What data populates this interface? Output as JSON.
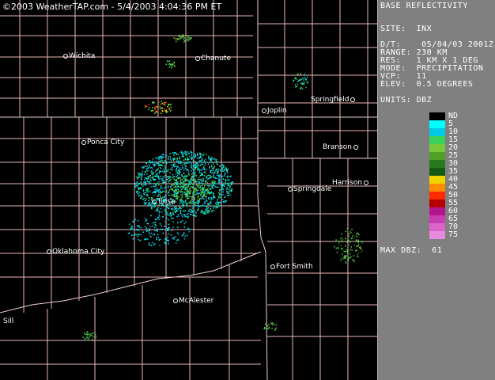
{
  "banner": "©2003 WeatherTAP.com - 5/4/2003 4:04:36 PM ET",
  "cities": [
    {
      "name": "Wichita",
      "dot_first": true
    },
    {
      "name": "Chanute",
      "dot_first": true
    },
    {
      "name": "Joplin",
      "dot_first": true
    },
    {
      "name": "Springfield",
      "dot_first": false
    },
    {
      "name": "Ponca City",
      "dot_first": true
    },
    {
      "name": "Branson",
      "dot_first": false
    },
    {
      "name": "Harrison",
      "dot_first": false
    },
    {
      "name": "Springdale",
      "dot_first": true
    },
    {
      "name": "Tulsa",
      "dot_first": true
    },
    {
      "name": "Oklahoma City",
      "dot_first": true
    },
    {
      "name": "Fort Smith",
      "dot_first": true
    },
    {
      "name": "McAlester",
      "dot_first": true
    },
    {
      "name": "Sill",
      "dot_first": false
    }
  ],
  "panel": {
    "title": "BASE REFLECTIVITY",
    "site": "SITE:  INX",
    "dt": "D/T:    05/04/03 2001Z",
    "range": "RANGE: 230 KM",
    "res": "RES:   1 KM X 1 DEG",
    "mode": "MODE:  PRECIPITATION",
    "vcp": "VCP:   11",
    "elev": "ELEV:  0.5 DEGREES",
    "units": "UNITS: DBZ",
    "max_dbz": "MAX DBZ:  61"
  },
  "legend": [
    {
      "label": "ND",
      "color": "#000000"
    },
    {
      "label": "5",
      "color": "#00ffff"
    },
    {
      "label": "10",
      "color": "#00c8e6"
    },
    {
      "label": "15",
      "color": "#3cd25a"
    },
    {
      "label": "20",
      "color": "#78c83c"
    },
    {
      "label": "25",
      "color": "#50a028"
    },
    {
      "label": "30",
      "color": "#287a1e"
    },
    {
      "label": "35",
      "color": "#145a14"
    },
    {
      "label": "40",
      "color": "#f0d200"
    },
    {
      "label": "45",
      "color": "#ff8c00"
    },
    {
      "label": "50",
      "color": "#ff2a00"
    },
    {
      "label": "55",
      "color": "#b40000"
    },
    {
      "label": "60",
      "color": "#b4148c"
    },
    {
      "label": "65",
      "color": "#c83cb4"
    },
    {
      "label": "70",
      "color": "#dc64c8"
    },
    {
      "label": "75",
      "color": "#e68cdc"
    }
  ]
}
